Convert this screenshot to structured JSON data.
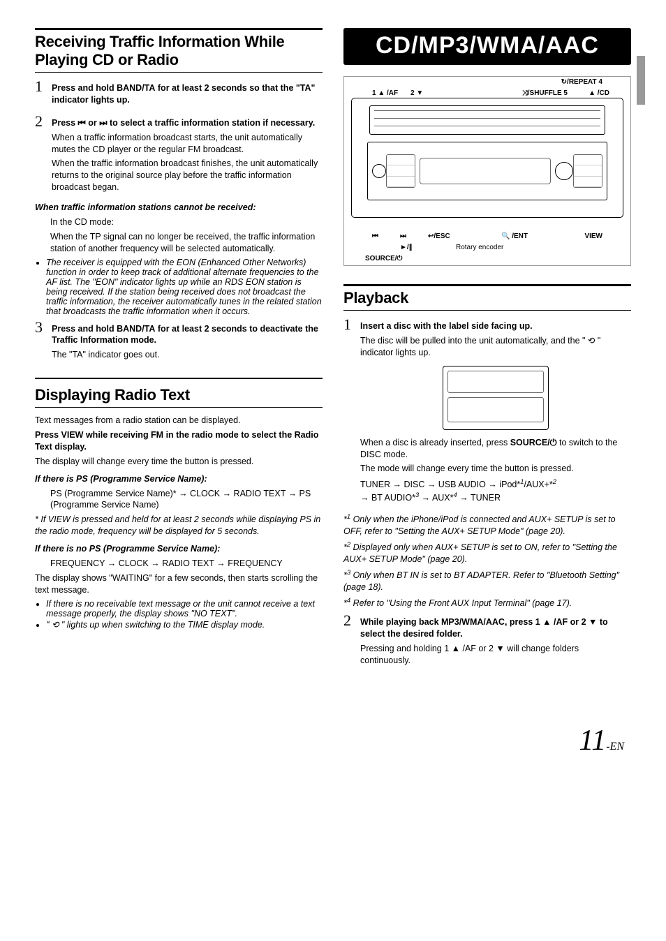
{
  "left": {
    "title1": "Receiving Traffic Information While Playing CD or Radio",
    "step1": {
      "head_a": "Press and hold ",
      "head_b": "BAND/TA",
      "head_c": " for at least 2 seconds so that the \"TA\" indicator lights up."
    },
    "step2": {
      "head_a": "Press  ⏮  or  ⏭  to select a traffic information station if necessary.",
      "p1": "When a traffic information broadcast starts, the unit automatically mutes the CD player or the regular FM broadcast.",
      "p2": "When the traffic information broadcast finishes, the unit automatically returns to the original source play before the traffic information broadcast began.",
      "sub_it": "When traffic information stations cannot be received:",
      "p3": "In the CD mode:",
      "p4": "When the TP signal can no longer be received, the traffic information station of another frequency will be selected automatically."
    },
    "eon_note": "The receiver is equipped with the EON (Enhanced Other Networks) function in order to keep track of additional alternate frequencies to the AF list. The \"EON\" indicator lights up while an RDS EON station is being received. If the station being received does not broadcast the traffic information, the receiver automatically tunes in the related station that broadcasts the traffic information when it occurs.",
    "step3": {
      "head_a": "Press and hold ",
      "head_b": "BAND/TA",
      "head_c": " for at least 2 seconds to deactivate the Traffic Information mode.",
      "p1": "The \"TA\" indicator goes out."
    },
    "title2": "Displaying Radio Text",
    "rt_intro": "Text messages from a radio station can be displayed.",
    "rt_press_a": "Press ",
    "rt_press_b": "VIEW",
    "rt_press_c": " while receiving FM in the radio mode to select the Radio Text display.",
    "rt_p1": "The display will change every time the button is pressed.",
    "rt_ps_yes_head": "If there is PS (Programme Service Name):",
    "rt_ps_yes_seq": "PS (Programme Service Name)* → CLOCK → RADIO TEXT → PS (Programme Service Name)",
    "rt_ps_note": "If VIEW is pressed and held for at least 2 seconds while displaying PS in the radio mode, frequency will be displayed for 5 seconds.",
    "rt_ps_no_head": "If there is no PS (Programme Service Name):",
    "rt_ps_no_seq": "FREQUENCY → CLOCK → RADIO TEXT → FREQUENCY",
    "rt_wait": "The display shows \"WAITING\" for a few seconds, then starts scrolling the text message.",
    "rt_b1": "If there is no receivable text message or the unit cannot receive a text message properly, the display shows \"NO TEXT\".",
    "rt_b2": "\" ⟲ \" lights up when switching to the TIME display mode."
  },
  "right": {
    "banner": "CD/MP3/WMA/AAC",
    "diag": {
      "repeat": "↻/REPEAT 4",
      "af": "1 ▲ /AF",
      "two": "2 ▼",
      "shuffle": "⤨/SHUFFLE 5",
      "cd": "▲ /CD",
      "prev": "⏮",
      "next": "⏭",
      "esc": "↩/ESC",
      "ent": "🔍 /ENT",
      "view": "VIEW",
      "play": "►/∥",
      "rotary": "Rotary encoder",
      "source": "SOURCE/⏻"
    },
    "title_playback": "Playback",
    "pb1": {
      "head": "Insert a disc with the label side facing up.",
      "p1": "The disc will be pulled into the unit automatically, and the \" ⟲ \" indicator lights up.",
      "p2a": "When a disc is already inserted, press ",
      "p2b": "SOURCE/⏻",
      "p2c": " to switch to the DISC mode.",
      "p3": "The mode will change every time the button is pressed.",
      "seq_a": "TUNER → DISC → USB AUDIO → iPod*",
      "seq_a2": "/AUX+*",
      "seq_b": "→ BT AUDIO*",
      "seq_b2": " → AUX*",
      "seq_b3": " → TUNER"
    },
    "fn1": "Only when the iPhone/iPod is connected and AUX+ SETUP is set to OFF, refer to \"Setting the AUX+ SETUP Mode\" (page 20).",
    "fn2": "Displayed only when AUX+ SETUP is set to ON, refer to \"Setting the AUX+ SETUP Mode\" (page 20).",
    "fn3": "Only when BT IN is set to BT ADAPTER. Refer to \"Bluetooth Setting\" (page 18).",
    "fn4": "Refer to \"Using the Front AUX Input Terminal\" (page 17).",
    "pb2": {
      "head_a": "While playing back MP3/WMA/AAC, press ",
      "head_b": "1 ▲ /AF",
      "head_c": " or ",
      "head_d": "2 ▼",
      "head_e": " to select the desired folder.",
      "p1": "Pressing and holding 1 ▲ /AF or 2 ▼  will change folders continuously."
    }
  },
  "page": {
    "num": "11",
    "suffix": "-EN"
  }
}
